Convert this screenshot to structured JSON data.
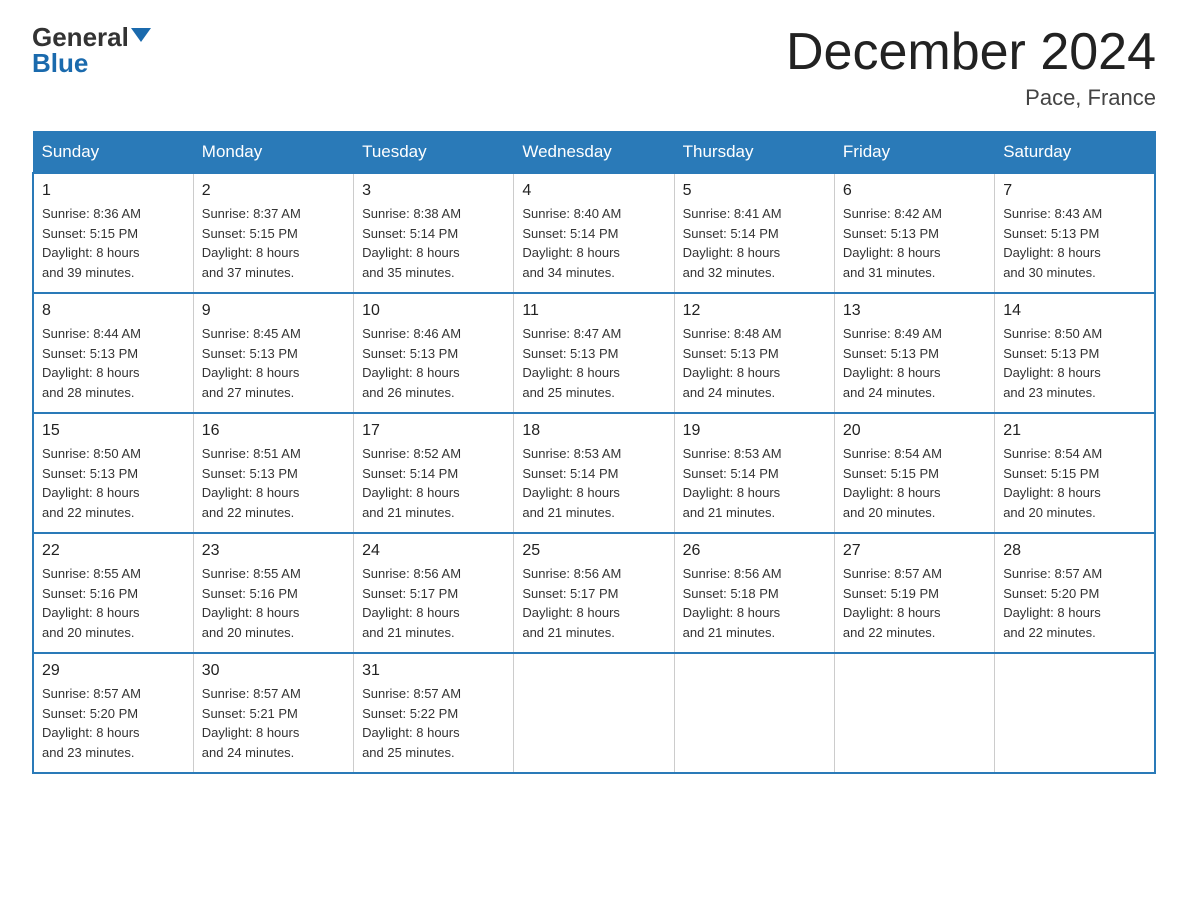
{
  "header": {
    "logo_general": "General",
    "logo_blue": "Blue",
    "month_title": "December 2024",
    "location": "Pace, France"
  },
  "days_of_week": [
    "Sunday",
    "Monday",
    "Tuesday",
    "Wednesday",
    "Thursday",
    "Friday",
    "Saturday"
  ],
  "weeks": [
    [
      {
        "day": "1",
        "sunrise": "Sunrise: 8:36 AM",
        "sunset": "Sunset: 5:15 PM",
        "daylight": "Daylight: 8 hours",
        "daylight2": "and 39 minutes."
      },
      {
        "day": "2",
        "sunrise": "Sunrise: 8:37 AM",
        "sunset": "Sunset: 5:15 PM",
        "daylight": "Daylight: 8 hours",
        "daylight2": "and 37 minutes."
      },
      {
        "day": "3",
        "sunrise": "Sunrise: 8:38 AM",
        "sunset": "Sunset: 5:14 PM",
        "daylight": "Daylight: 8 hours",
        "daylight2": "and 35 minutes."
      },
      {
        "day": "4",
        "sunrise": "Sunrise: 8:40 AM",
        "sunset": "Sunset: 5:14 PM",
        "daylight": "Daylight: 8 hours",
        "daylight2": "and 34 minutes."
      },
      {
        "day": "5",
        "sunrise": "Sunrise: 8:41 AM",
        "sunset": "Sunset: 5:14 PM",
        "daylight": "Daylight: 8 hours",
        "daylight2": "and 32 minutes."
      },
      {
        "day": "6",
        "sunrise": "Sunrise: 8:42 AM",
        "sunset": "Sunset: 5:13 PM",
        "daylight": "Daylight: 8 hours",
        "daylight2": "and 31 minutes."
      },
      {
        "day": "7",
        "sunrise": "Sunrise: 8:43 AM",
        "sunset": "Sunset: 5:13 PM",
        "daylight": "Daylight: 8 hours",
        "daylight2": "and 30 minutes."
      }
    ],
    [
      {
        "day": "8",
        "sunrise": "Sunrise: 8:44 AM",
        "sunset": "Sunset: 5:13 PM",
        "daylight": "Daylight: 8 hours",
        "daylight2": "and 28 minutes."
      },
      {
        "day": "9",
        "sunrise": "Sunrise: 8:45 AM",
        "sunset": "Sunset: 5:13 PM",
        "daylight": "Daylight: 8 hours",
        "daylight2": "and 27 minutes."
      },
      {
        "day": "10",
        "sunrise": "Sunrise: 8:46 AM",
        "sunset": "Sunset: 5:13 PM",
        "daylight": "Daylight: 8 hours",
        "daylight2": "and 26 minutes."
      },
      {
        "day": "11",
        "sunrise": "Sunrise: 8:47 AM",
        "sunset": "Sunset: 5:13 PM",
        "daylight": "Daylight: 8 hours",
        "daylight2": "and 25 minutes."
      },
      {
        "day": "12",
        "sunrise": "Sunrise: 8:48 AM",
        "sunset": "Sunset: 5:13 PM",
        "daylight": "Daylight: 8 hours",
        "daylight2": "and 24 minutes."
      },
      {
        "day": "13",
        "sunrise": "Sunrise: 8:49 AM",
        "sunset": "Sunset: 5:13 PM",
        "daylight": "Daylight: 8 hours",
        "daylight2": "and 24 minutes."
      },
      {
        "day": "14",
        "sunrise": "Sunrise: 8:50 AM",
        "sunset": "Sunset: 5:13 PM",
        "daylight": "Daylight: 8 hours",
        "daylight2": "and 23 minutes."
      }
    ],
    [
      {
        "day": "15",
        "sunrise": "Sunrise: 8:50 AM",
        "sunset": "Sunset: 5:13 PM",
        "daylight": "Daylight: 8 hours",
        "daylight2": "and 22 minutes."
      },
      {
        "day": "16",
        "sunrise": "Sunrise: 8:51 AM",
        "sunset": "Sunset: 5:13 PM",
        "daylight": "Daylight: 8 hours",
        "daylight2": "and 22 minutes."
      },
      {
        "day": "17",
        "sunrise": "Sunrise: 8:52 AM",
        "sunset": "Sunset: 5:14 PM",
        "daylight": "Daylight: 8 hours",
        "daylight2": "and 21 minutes."
      },
      {
        "day": "18",
        "sunrise": "Sunrise: 8:53 AM",
        "sunset": "Sunset: 5:14 PM",
        "daylight": "Daylight: 8 hours",
        "daylight2": "and 21 minutes."
      },
      {
        "day": "19",
        "sunrise": "Sunrise: 8:53 AM",
        "sunset": "Sunset: 5:14 PM",
        "daylight": "Daylight: 8 hours",
        "daylight2": "and 21 minutes."
      },
      {
        "day": "20",
        "sunrise": "Sunrise: 8:54 AM",
        "sunset": "Sunset: 5:15 PM",
        "daylight": "Daylight: 8 hours",
        "daylight2": "and 20 minutes."
      },
      {
        "day": "21",
        "sunrise": "Sunrise: 8:54 AM",
        "sunset": "Sunset: 5:15 PM",
        "daylight": "Daylight: 8 hours",
        "daylight2": "and 20 minutes."
      }
    ],
    [
      {
        "day": "22",
        "sunrise": "Sunrise: 8:55 AM",
        "sunset": "Sunset: 5:16 PM",
        "daylight": "Daylight: 8 hours",
        "daylight2": "and 20 minutes."
      },
      {
        "day": "23",
        "sunrise": "Sunrise: 8:55 AM",
        "sunset": "Sunset: 5:16 PM",
        "daylight": "Daylight: 8 hours",
        "daylight2": "and 20 minutes."
      },
      {
        "day": "24",
        "sunrise": "Sunrise: 8:56 AM",
        "sunset": "Sunset: 5:17 PM",
        "daylight": "Daylight: 8 hours",
        "daylight2": "and 21 minutes."
      },
      {
        "day": "25",
        "sunrise": "Sunrise: 8:56 AM",
        "sunset": "Sunset: 5:17 PM",
        "daylight": "Daylight: 8 hours",
        "daylight2": "and 21 minutes."
      },
      {
        "day": "26",
        "sunrise": "Sunrise: 8:56 AM",
        "sunset": "Sunset: 5:18 PM",
        "daylight": "Daylight: 8 hours",
        "daylight2": "and 21 minutes."
      },
      {
        "day": "27",
        "sunrise": "Sunrise: 8:57 AM",
        "sunset": "Sunset: 5:19 PM",
        "daylight": "Daylight: 8 hours",
        "daylight2": "and 22 minutes."
      },
      {
        "day": "28",
        "sunrise": "Sunrise: 8:57 AM",
        "sunset": "Sunset: 5:20 PM",
        "daylight": "Daylight: 8 hours",
        "daylight2": "and 22 minutes."
      }
    ],
    [
      {
        "day": "29",
        "sunrise": "Sunrise: 8:57 AM",
        "sunset": "Sunset: 5:20 PM",
        "daylight": "Daylight: 8 hours",
        "daylight2": "and 23 minutes."
      },
      {
        "day": "30",
        "sunrise": "Sunrise: 8:57 AM",
        "sunset": "Sunset: 5:21 PM",
        "daylight": "Daylight: 8 hours",
        "daylight2": "and 24 minutes."
      },
      {
        "day": "31",
        "sunrise": "Sunrise: 8:57 AM",
        "sunset": "Sunset: 5:22 PM",
        "daylight": "Daylight: 8 hours",
        "daylight2": "and 25 minutes."
      },
      null,
      null,
      null,
      null
    ]
  ]
}
